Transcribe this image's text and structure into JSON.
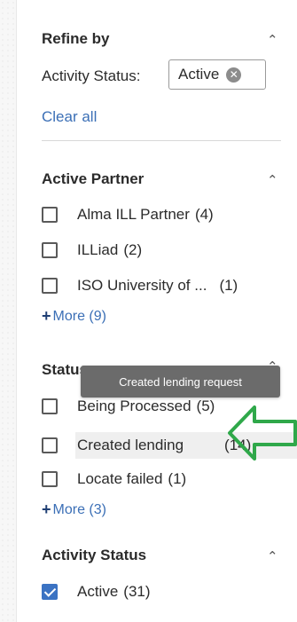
{
  "refine": {
    "title": "Refine by",
    "activity_status_label": "Activity Status:",
    "chip_value": "Active",
    "clear_all": "Clear all"
  },
  "sections": {
    "active_partner": {
      "title": "Active Partner",
      "items": [
        {
          "label": "Alma ILL Partner",
          "count": "(4)",
          "checked": false
        },
        {
          "label": "ILLiad",
          "count": "(2)",
          "checked": false
        },
        {
          "label": "ISO University of ...",
          "count": "(1)",
          "checked": false
        }
      ],
      "more": "More (9)"
    },
    "status": {
      "title": "Status",
      "tooltip": "Created lending request",
      "items": [
        {
          "label": "Being Processed",
          "count": "(5)",
          "checked": false
        },
        {
          "label": "Created lending",
          "count": "(14)",
          "checked": false
        },
        {
          "label": "Locate failed",
          "count": "(1)",
          "checked": false
        }
      ],
      "more": "More (3)"
    },
    "activity_status": {
      "title": "Activity Status",
      "items": [
        {
          "label": "Active",
          "count": "(31)",
          "checked": true
        }
      ]
    }
  },
  "icons": {
    "collapse": "chevron-up-icon",
    "clear_chip": "close-circle-icon",
    "more": "plus-icon",
    "annotation": "green-arrow"
  },
  "colors": {
    "accent": "#3b6fb6",
    "checkbox_checked": "#3b73c3",
    "annotation_arrow": "#2fa84a",
    "tooltip_bg": "#6b6b6b"
  }
}
